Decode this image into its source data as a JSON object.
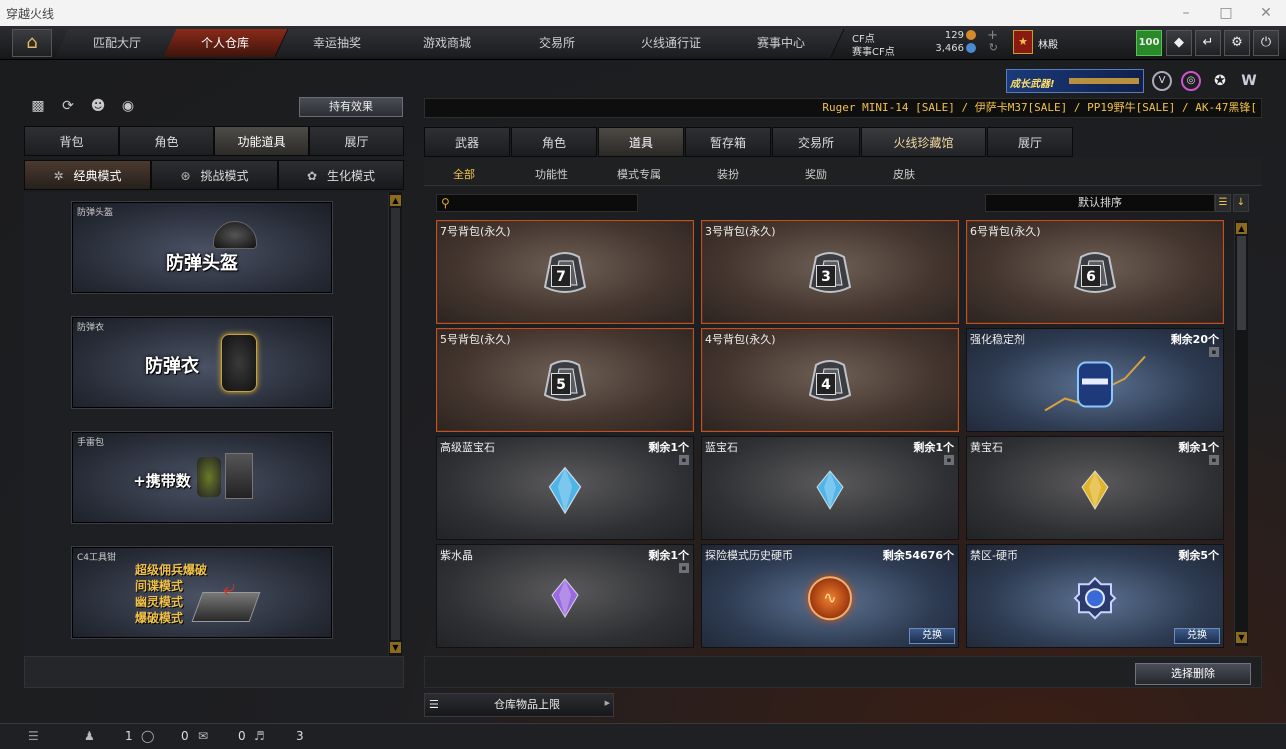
{
  "window": {
    "title": "穿越火线"
  },
  "nav": {
    "tabs": [
      "匹配大厅",
      "个人仓库",
      "幸运抽奖",
      "游戏商城",
      "交易所",
      "火线通行证",
      "赛事中心"
    ],
    "active_index": 1
  },
  "currency": {
    "cf_label": "CF点",
    "cf_value": "129",
    "event_label": "赛事CF点",
    "event_value": "3,466"
  },
  "player": {
    "name": "林殿",
    "level": "100"
  },
  "promo": {
    "text": "成长武器!"
  },
  "left": {
    "effect_button": "持有效果",
    "tabs": [
      "背包",
      "角色",
      "功能道具",
      "展厅"
    ],
    "tabs_active": 2,
    "modes": [
      "经典模式",
      "挑战模式",
      "生化模式"
    ],
    "modes_active": 0,
    "cards": [
      {
        "caption": "防弹头盔",
        "label": "防弹头盔"
      },
      {
        "caption": "防弹衣",
        "label": "防弹衣"
      },
      {
        "caption": "手雷包",
        "label": "+携带数"
      },
      {
        "caption": "C4工具钳",
        "lines": [
          "超级佣兵爆破",
          "间谍模式",
          "幽灵模式",
          "爆破模式"
        ]
      }
    ]
  },
  "ticker": "Ruger MINI-14  [SALE] / 伊萨卡M37[SALE] / PP19野牛[SALE] / AK-47黑锋[",
  "right": {
    "tabs": [
      "武器",
      "角色",
      "道具",
      "暂存箱",
      "交易所",
      "火线珍藏馆",
      "展厅"
    ],
    "tabs_active": 2,
    "subtabs": [
      "全部",
      "功能性",
      "模式专属",
      "装扮",
      "奖励",
      "皮肤"
    ],
    "subtabs_active": 0,
    "search": {
      "placeholder": ""
    },
    "sort": "默认排序",
    "items": [
      {
        "name": "7号背包(永久)",
        "count": "",
        "icon": "bag-icon",
        "num": "7",
        "style": "bag"
      },
      {
        "name": "3号背包(永久)",
        "count": "",
        "icon": "bag-icon",
        "num": "3",
        "style": "bag"
      },
      {
        "name": "6号背包(永久)",
        "count": "",
        "icon": "bag-icon",
        "num": "6",
        "style": "bag"
      },
      {
        "name": "5号背包(永久)",
        "count": "",
        "icon": "bag-icon",
        "num": "5",
        "style": "bag"
      },
      {
        "name": "4号背包(永久)",
        "count": "",
        "icon": "bag-icon",
        "num": "4",
        "style": "bag"
      },
      {
        "name": "强化稳定剂",
        "count": "剩余20个",
        "icon": "stabilizer-icon",
        "style": "blue",
        "lock": true
      },
      {
        "name": "高级蓝宝石",
        "count": "剩余1个",
        "icon": "sapphire-icon",
        "style": "gray",
        "lock": true,
        "color": "#4fb4e8"
      },
      {
        "name": "蓝宝石",
        "count": "剩余1个",
        "icon": "sapphire-icon",
        "style": "gray",
        "lock": true,
        "color": "#4fb4e8"
      },
      {
        "name": "黄宝石",
        "count": "剩余1个",
        "icon": "topaz-icon",
        "style": "gray",
        "lock": true,
        "color": "#e0b42a"
      },
      {
        "name": "紫水晶",
        "count": "剩余1个",
        "icon": "amethyst-icon",
        "style": "gray",
        "lock": true,
        "color": "#9a6ae0"
      },
      {
        "name": "探险模式历史硬币",
        "count": "剩余54676个",
        "icon": "coin-icon",
        "style": "blue",
        "exchange": "兑换"
      },
      {
        "name": "禁区-硬币",
        "count": "剩余5个",
        "icon": "gear-coin-icon",
        "style": "blue",
        "exchange": "兑换"
      }
    ],
    "delete_button": "选择删除",
    "capacity_label": "仓库物品上限"
  },
  "status": {
    "count1": "1",
    "count2": "0",
    "count3": "0",
    "count4": "3"
  }
}
